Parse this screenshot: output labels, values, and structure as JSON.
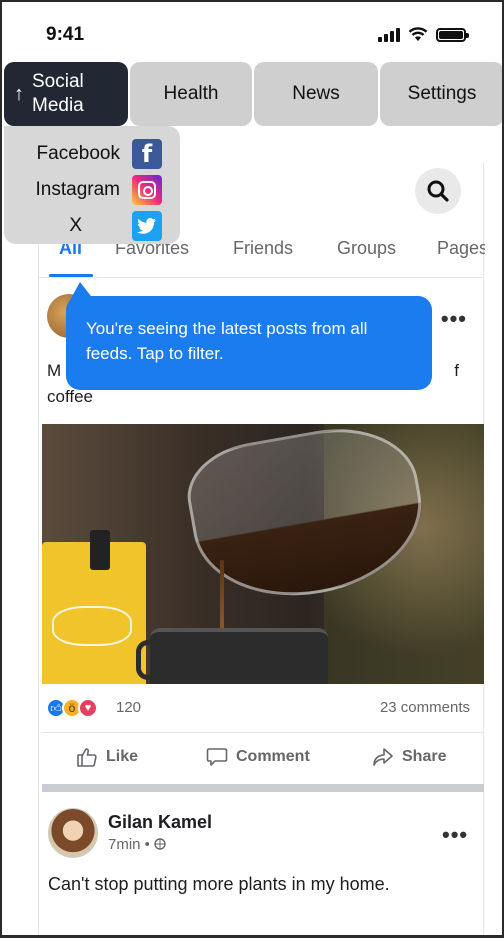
{
  "status_bar": {
    "time": "9:41",
    "icons": [
      "signal-icon",
      "wifi-icon",
      "battery-icon"
    ]
  },
  "category_tabs": [
    {
      "label": "Social Media",
      "active": true,
      "icon": "arrow-up-icon"
    },
    {
      "label": "Health",
      "active": false
    },
    {
      "label": "News",
      "active": false
    },
    {
      "label": "Settings",
      "active": false
    }
  ],
  "social_dropdown": [
    {
      "label": "Facebook",
      "icon": "facebook-icon"
    },
    {
      "label": "Instagram",
      "icon": "instagram-icon"
    },
    {
      "label": "X",
      "icon": "twitter-icon"
    }
  ],
  "feed": {
    "search_icon": "search-icon",
    "tabs": [
      "All",
      "Favorites",
      "Friends",
      "Groups",
      "Pages"
    ],
    "active_tab": "All"
  },
  "tooltip": {
    "text": "You're seeing the latest posts from all feeds. Tap to filter."
  },
  "post1": {
    "text_start": "M",
    "text_end": "f",
    "text_line2": "coffee",
    "reaction_count": "120",
    "comments": "23 comments",
    "actions": {
      "like": "Like",
      "comment": "Comment",
      "share": "Share"
    },
    "more_icon": "more-horizontal-icon"
  },
  "post2": {
    "author": "Gilan Kamel",
    "meta": "7min • ",
    "text": "Can't stop putting more plants in my home.",
    "more_icon": "more-horizontal-icon"
  },
  "colors": {
    "active_tab_bg": "#212833",
    "inactive_tab_bg": "#cfcfcf",
    "facebook_blue": "#1877f2",
    "tooltip_blue": "#1b7cf0"
  }
}
